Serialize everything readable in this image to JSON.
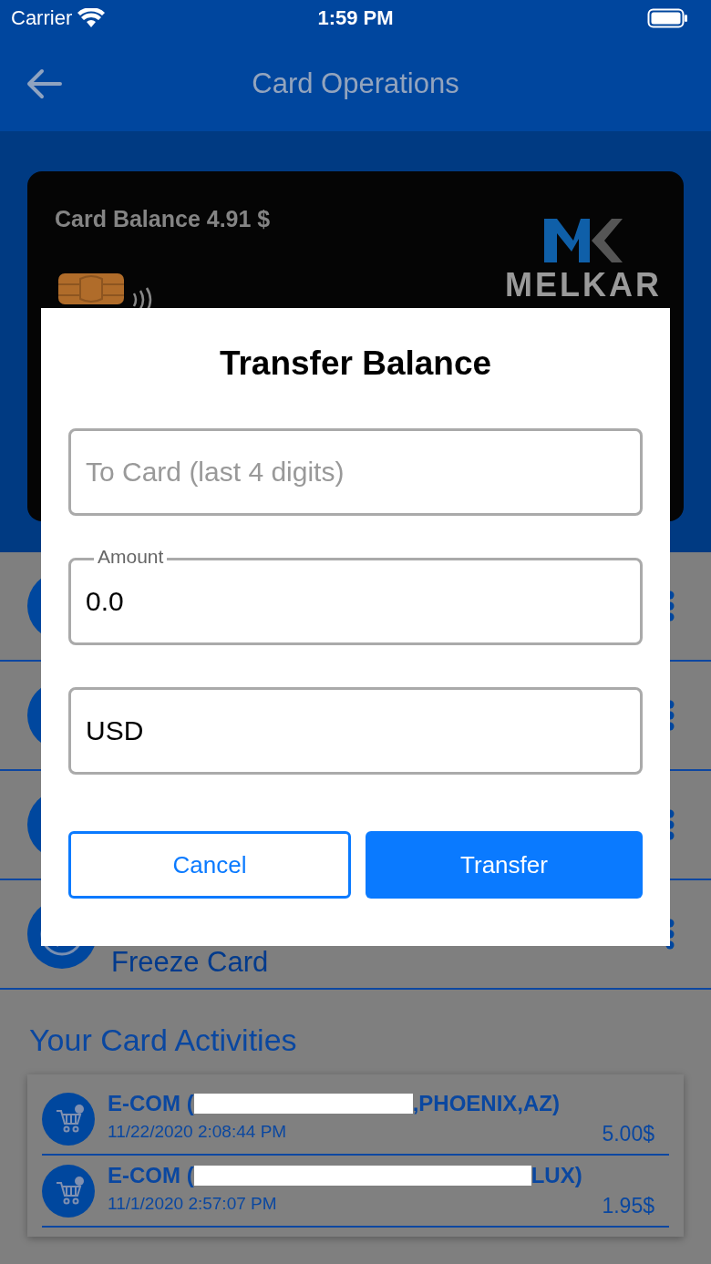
{
  "status_bar": {
    "carrier": "Carrier",
    "time": "1:59 PM"
  },
  "header": {
    "title": "Card Operations"
  },
  "card": {
    "balance": "Card Balance 4.91 $",
    "brand": "MELKAR"
  },
  "operation_rows": [
    {
      "kind": "hidden"
    },
    {
      "kind": "hidden"
    },
    {
      "kind": "hidden"
    },
    {
      "kind": "labeled",
      "label": "Freeze Card"
    }
  ],
  "activities": {
    "title": "Your Card Activities",
    "items": [
      {
        "title_start": "E-COM (",
        "title_end": ",PHOENIX,AZ)",
        "date": "11/22/2020 2:08:44 PM",
        "amount": "5.00$"
      },
      {
        "title_start": "E-COM (",
        "title_end": "LUX)",
        "date": "11/1/2020 2:57:07 PM",
        "amount": "1.95$"
      }
    ]
  },
  "dialog": {
    "title": "Transfer Balance",
    "fields": [
      {
        "kind": "placeholder",
        "placeholder": "To Card (last 4 digits)"
      },
      {
        "kind": "labeled",
        "label": "Amount",
        "value": "0.0"
      },
      {
        "kind": "plain",
        "value": "USD"
      }
    ],
    "buttons": [
      {
        "label": "Cancel",
        "kind": "outline"
      },
      {
        "label": "Transfer",
        "kind": "filled"
      }
    ]
  }
}
